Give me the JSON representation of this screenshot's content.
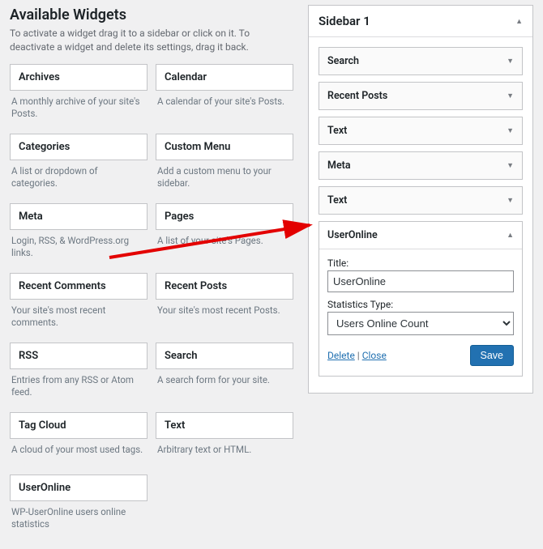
{
  "available": {
    "title": "Available Widgets",
    "hint": "To activate a widget drag it to a sidebar or click on it. To deactivate a widget and delete its settings, drag it back.",
    "widgets": [
      {
        "name": "Archives",
        "desc": "A monthly archive of your site's Posts."
      },
      {
        "name": "Calendar",
        "desc": "A calendar of your site's Posts."
      },
      {
        "name": "Categories",
        "desc": "A list or dropdown of categories."
      },
      {
        "name": "Custom Menu",
        "desc": "Add a custom menu to your sidebar."
      },
      {
        "name": "Meta",
        "desc": "Login, RSS, & WordPress.org links."
      },
      {
        "name": "Pages",
        "desc": "A list of your site's Pages."
      },
      {
        "name": "Recent Comments",
        "desc": "Your site's most recent comments."
      },
      {
        "name": "Recent Posts",
        "desc": "Your site's most recent Posts."
      },
      {
        "name": "RSS",
        "desc": "Entries from any RSS or Atom feed."
      },
      {
        "name": "Search",
        "desc": "A search form for your site."
      },
      {
        "name": "Tag Cloud",
        "desc": "A cloud of your most used tags."
      },
      {
        "name": "Text",
        "desc": "Arbitrary text or HTML."
      },
      {
        "name": "UserOnline",
        "desc": "WP-UserOnline users online statistics"
      }
    ]
  },
  "sidebar": {
    "title": "Sidebar 1",
    "slots": [
      {
        "name": "Search"
      },
      {
        "name": "Recent Posts"
      },
      {
        "name": "Text"
      },
      {
        "name": "Meta"
      },
      {
        "name": "Text"
      }
    ],
    "open": {
      "name": "UserOnline",
      "title_label": "Title:",
      "title_value": "UserOnline",
      "stat_label": "Statistics Type:",
      "stat_value": "Users Online Count",
      "delete": "Delete",
      "close": "Close",
      "save": "Save",
      "sep": " | "
    }
  }
}
